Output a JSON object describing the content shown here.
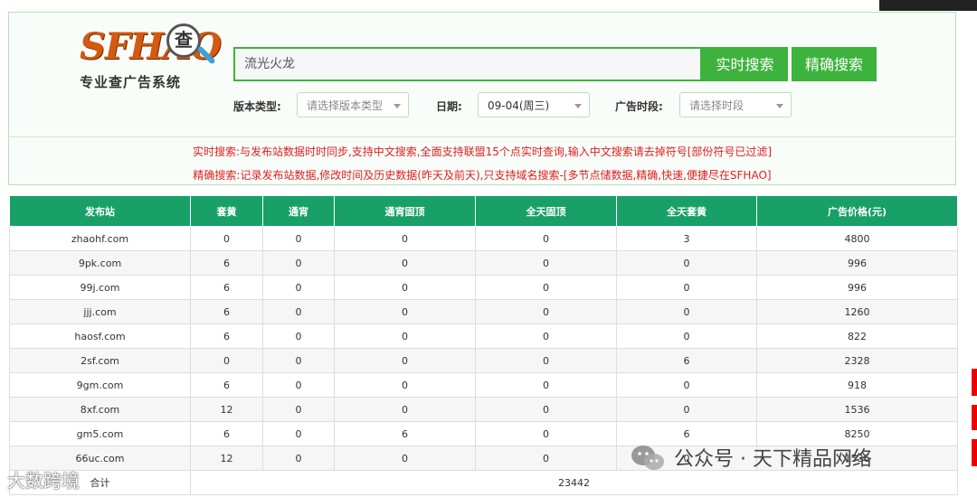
{
  "header": {
    "logo_brand": "SFHAO",
    "logo_cha": "查",
    "logo_sub": "专业查广告系统"
  },
  "search": {
    "value": "流光火龙",
    "realtime_label": "实时搜索",
    "exact_label": "精确搜索"
  },
  "filters": {
    "version_label": "版本类型:",
    "version_placeholder": "请选择版本类型",
    "date_label": "日期:",
    "date_value": "09-04(周三)",
    "period_label": "广告时段:",
    "period_placeholder": "请选择时段"
  },
  "info": {
    "line1": "实时搜索:与发布站数据时时同步,支持中文搜索,全面支持联盟15个点实时查询,输入中文搜索请去掉符号[部份符号已过滤]",
    "line2": "精确搜索:记录发布站数据,修改时间及历史数据(昨天及前天),只支持域名搜索-[多节点储数据,精确,快速,便捷尽在SFHAO]"
  },
  "table": {
    "columns": [
      "发布站",
      "套黄",
      "通宵",
      "通宵固顶",
      "全天固顶",
      "全天套黄",
      "广告价格(元)"
    ],
    "rows": [
      [
        "zhaohf.com",
        "0",
        "0",
        "0",
        "0",
        "3",
        "4800"
      ],
      [
        "9pk.com",
        "6",
        "0",
        "0",
        "0",
        "0",
        "996"
      ],
      [
        "99j.com",
        "6",
        "0",
        "0",
        "0",
        "0",
        "996"
      ],
      [
        "jjj.com",
        "6",
        "0",
        "0",
        "0",
        "0",
        "1260"
      ],
      [
        "haosf.com",
        "6",
        "0",
        "0",
        "0",
        "0",
        "822"
      ],
      [
        "2sf.com",
        "0",
        "0",
        "0",
        "0",
        "6",
        "2328"
      ],
      [
        "9gm.com",
        "6",
        "0",
        "0",
        "0",
        "0",
        "918"
      ],
      [
        "8xf.com",
        "12",
        "0",
        "0",
        "0",
        "0",
        "1536"
      ],
      [
        "gm5.com",
        "6",
        "0",
        "6",
        "0",
        "6",
        "8250"
      ],
      [
        "66uc.com",
        "12",
        "0",
        "0",
        "0",
        "0",
        "1536"
      ]
    ],
    "total_label": "合计",
    "total_value": "23442"
  },
  "watermarks": {
    "right": "公众号 · 天下精品网络",
    "left": "大数跨境"
  },
  "colors": {
    "green": "#3db33d",
    "header_green": "#18a068",
    "info_red": "#e02020",
    "logo_orange": "#d35a10"
  }
}
